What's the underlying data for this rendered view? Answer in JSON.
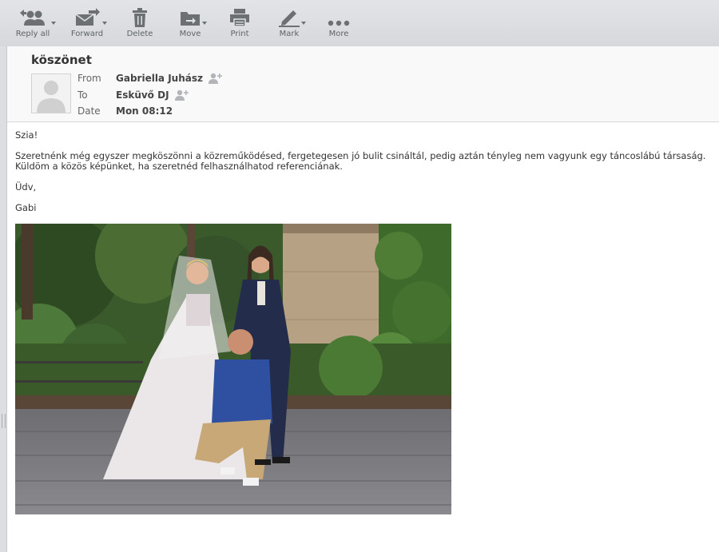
{
  "toolbar": {
    "buttons": [
      {
        "label": "Reply all",
        "icon": "reply-all-icon",
        "dropdown": true
      },
      {
        "label": "Forward",
        "icon": "forward-icon",
        "dropdown": true
      },
      {
        "label": "Delete",
        "icon": "trash-icon",
        "dropdown": false
      },
      {
        "label": "Move",
        "icon": "folder-move-icon",
        "dropdown": true
      },
      {
        "label": "Print",
        "icon": "printer-icon",
        "dropdown": false
      },
      {
        "label": "Mark",
        "icon": "pencil-icon",
        "dropdown": true
      },
      {
        "label": "More",
        "icon": "ellipsis-icon",
        "dropdown": false
      }
    ]
  },
  "message": {
    "subject": "köszönet",
    "from_label": "From",
    "from_value": "Gabriella Juhász",
    "to_label": "To",
    "to_value": "Esküvő DJ",
    "date_label": "Date",
    "date_value": "Mon 08:12",
    "body": {
      "greeting": "Szia!",
      "line1": "Szeretnénk még egyszer megköszönni a közreműködésed, fergetegesen jó bulit csináltál, pedig aztán tényleg nem vagyunk egy táncoslábú társaság.",
      "line2": "Küldöm a közös képünket, ha szeretnéd felhasználhatod referenciának.",
      "closing": "Üdv,",
      "signature": "Gabi"
    },
    "attachment": {
      "type": "inline-image",
      "icon": "wedding-photo"
    }
  },
  "colors": {
    "toolbar_bg": "#d9dbde",
    "header_bg": "#f9f9f9",
    "icon_gray": "#6d7073",
    "pane_bg": "#ffffff"
  }
}
